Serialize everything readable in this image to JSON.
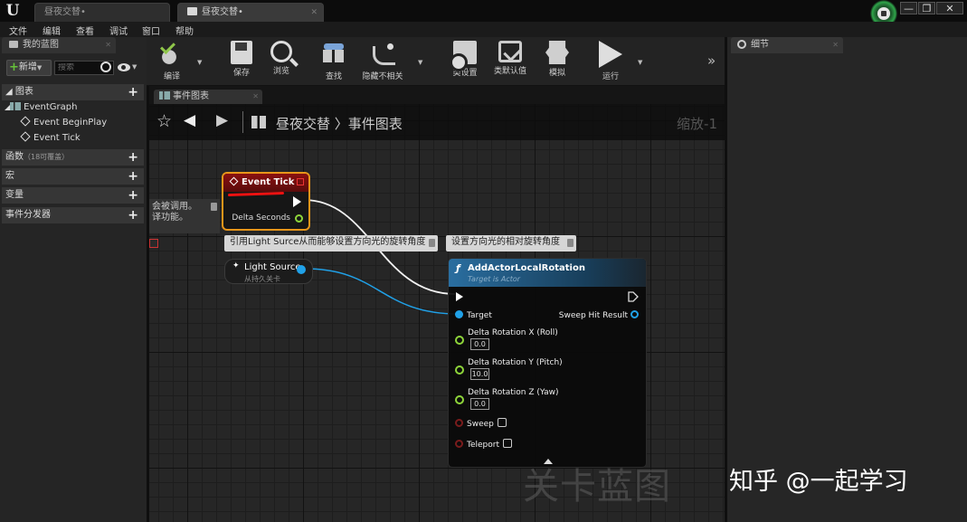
{
  "window": {
    "tabs": [
      {
        "label": "昼夜交替•"
      },
      {
        "label": "昼夜交替•"
      }
    ],
    "controls": {
      "minimize": "—",
      "restore": "❐",
      "close": "✕"
    }
  },
  "menu": [
    "文件",
    "编辑",
    "查看",
    "调试",
    "窗口",
    "帮助"
  ],
  "my_blueprint": {
    "tab_label": "我的蓝图",
    "add_label": "新增",
    "search_placeholder": "搜索",
    "sections": {
      "graphs": "图表",
      "functions": "函数",
      "functions_sub": "（18可覆盖）",
      "macros": "宏",
      "variables": "变量",
      "dispatchers": "事件分发器"
    },
    "tree": {
      "event_graph": "EventGraph",
      "begin_play": "Event BeginPlay",
      "tick": "Event Tick"
    }
  },
  "toolbar": {
    "compile": "编译",
    "save": "保存",
    "browse": "浏览",
    "find": "查找",
    "hide_unrelated": "隐藏不相关",
    "class_settings": "类设置",
    "class_defaults": "类默认值",
    "simulate": "模拟",
    "play": "运行",
    "more": "»"
  },
  "graph": {
    "tab_label": "事件图表",
    "breadcrumb": "昼夜交替 〉事件图表",
    "zoom": "缩放-1",
    "partial_comment": "会被调用。\n译功能。",
    "comment_light": "引用Light Surce从而能够设置方向光的旋转角度",
    "comment_rotation": "设置方向光的相对旋转角度",
    "event_tick": {
      "title": "Event Tick",
      "delta_label": "Delta Seconds"
    },
    "light_source": {
      "title": "Light Source",
      "subtitle": "从持久关卡"
    },
    "add_rotation": {
      "title": "AddActorLocalRotation",
      "subtitle": "Target is Actor",
      "target": "Target",
      "sweep_hit": "Sweep Hit Result",
      "rot_x_label": "Delta Rotation X (Roll)",
      "rot_x": "0.0",
      "rot_y_label": "Delta Rotation Y (Pitch)",
      "rot_y": "10.0",
      "rot_z_label": "Delta Rotation Z (Yaw)",
      "rot_z": "0.0",
      "sweep": "Sweep",
      "teleport": "Teleport"
    },
    "watermark": "关卡蓝图"
  },
  "details": {
    "tab_label": "细节"
  },
  "overlay": {
    "zhihu": "知乎 @一起学习"
  },
  "colors": {
    "exec_wire": "#ffffff",
    "object_wire": "#20a1e8",
    "event_header": "#8a1010",
    "function_header": "#2a6ea0",
    "selection": "#e8961a"
  }
}
